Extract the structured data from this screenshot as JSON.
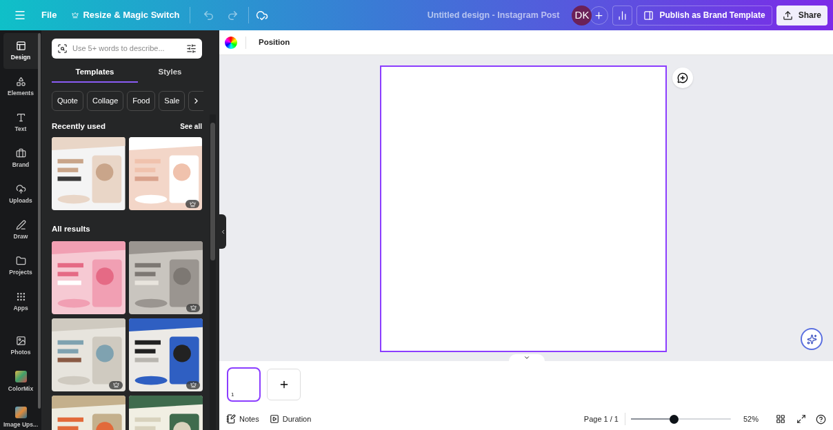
{
  "topbar": {
    "file": "File",
    "resize": "Resize & Magic Switch",
    "title": "Untitled design - Instagram Post",
    "avatar": "DK",
    "publish": "Publish as Brand Template",
    "share": "Share"
  },
  "sidebar": {
    "items": [
      {
        "kind": "design",
        "label": "Design",
        "selected": true
      },
      {
        "kind": "elements",
        "label": "Elements",
        "selected": false
      },
      {
        "kind": "text",
        "label": "Text",
        "selected": false
      },
      {
        "kind": "brand",
        "label": "Brand",
        "selected": false
      },
      {
        "kind": "uploads",
        "label": "Uploads",
        "selected": false
      },
      {
        "kind": "draw",
        "label": "Draw",
        "selected": false
      },
      {
        "kind": "projects",
        "label": "Projects",
        "selected": false
      },
      {
        "kind": "apps",
        "label": "Apps",
        "selected": false
      },
      {
        "kind": "divider"
      },
      {
        "kind": "photos",
        "label": "Photos",
        "selected": false
      },
      {
        "kind": "colormix",
        "label": "ColorMix",
        "selected": false
      },
      {
        "kind": "imageups",
        "label": "Image Ups...",
        "selected": false
      }
    ]
  },
  "panel": {
    "search": {
      "placeholder": "Use 5+ words to describe..."
    },
    "tabs": [
      {
        "label": "Templates",
        "selected": true
      },
      {
        "label": "Styles",
        "selected": false
      }
    ],
    "chips": [
      "Quote",
      "Collage",
      "Food",
      "Sale"
    ],
    "recently_used": {
      "title": "Recently used",
      "see_all": "See all",
      "templates": [
        {
          "kind": "picture",
          "premium": false
        },
        {
          "kind": "picture",
          "premium": true
        }
      ]
    },
    "all_results": {
      "title": "All results",
      "templates": [
        {
          "kind": "picture",
          "premium": false
        },
        {
          "kind": "picture",
          "premium": true
        },
        {
          "kind": "picture",
          "premium": true
        },
        {
          "kind": "picture",
          "premium": true
        },
        {
          "kind": "picture",
          "premium": false
        },
        {
          "kind": "picture",
          "premium": false
        }
      ]
    }
  },
  "toolbar": {
    "position": "Position"
  },
  "pages": [
    {
      "number": "1",
      "selected": true
    }
  ],
  "footer": {
    "notes": "Notes",
    "duration": "Duration",
    "page": "Page 1 / 1",
    "zoom": {
      "level": 0.43
    },
    "zoom_reading": "52%"
  }
}
